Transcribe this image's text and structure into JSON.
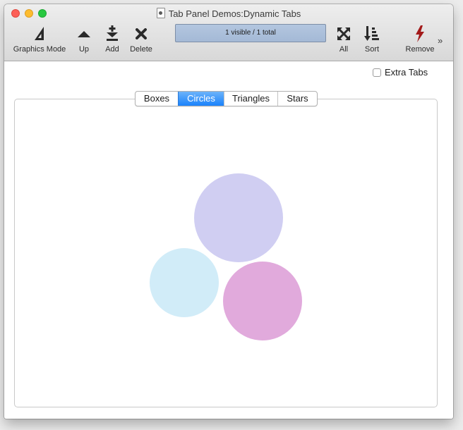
{
  "window": {
    "title": "Tab Panel Demos:Dynamic Tabs"
  },
  "toolbar": {
    "graphics_mode_label": "Graphics Mode",
    "up_label": "Up",
    "add_label": "Add",
    "delete_label": "Delete",
    "status_text": "1 visible / 1 total",
    "all_label": "All",
    "sort_label": "Sort",
    "remove_label": "Remove",
    "overflow": "»"
  },
  "options": {
    "extra_tabs_label": "Extra Tabs",
    "extra_tabs_checked": false
  },
  "tabs": [
    {
      "label": "Boxes",
      "selected": false
    },
    {
      "label": "Circles",
      "selected": true
    },
    {
      "label": "Triangles",
      "selected": false
    },
    {
      "label": "Stars",
      "selected": false
    }
  ],
  "circles": [
    {
      "name": "lavender-circle",
      "color": "#d0cef2"
    },
    {
      "name": "light-blue-circle",
      "color": "#d1ecf8"
    },
    {
      "name": "pink-circle",
      "color": "#e1aadc"
    }
  ],
  "colors": {
    "selected_tab": "#1a82fb",
    "remove_icon": "#a31a1a",
    "status_box": "#a9bdd8"
  }
}
